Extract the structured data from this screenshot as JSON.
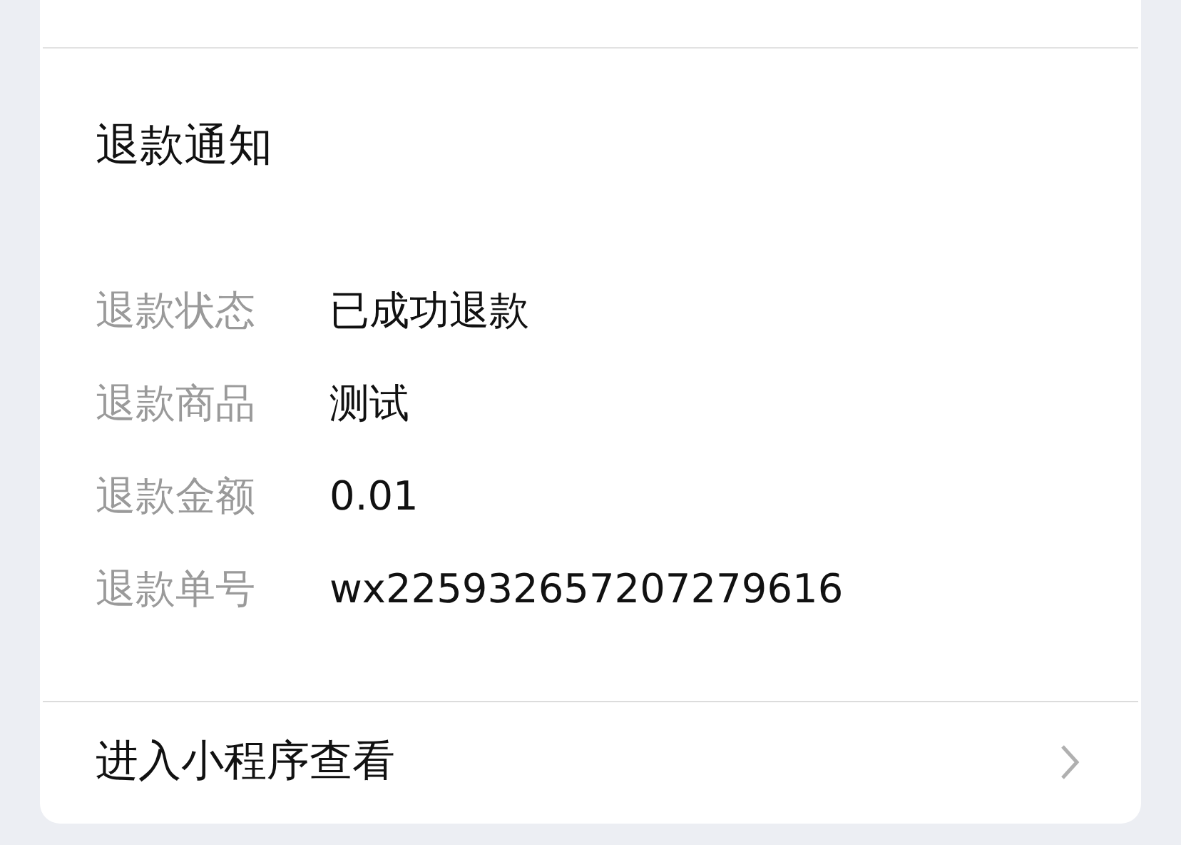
{
  "card": {
    "title": "退款通知",
    "fields": [
      {
        "label": "退款状态",
        "value": "已成功退款"
      },
      {
        "label": "退款商品",
        "value": "测试"
      },
      {
        "label": "退款金额",
        "value": "0.01"
      },
      {
        "label": "退款单号",
        "value": "wx225932657207279616"
      }
    ],
    "action": {
      "label": "进入小程序查看"
    }
  }
}
